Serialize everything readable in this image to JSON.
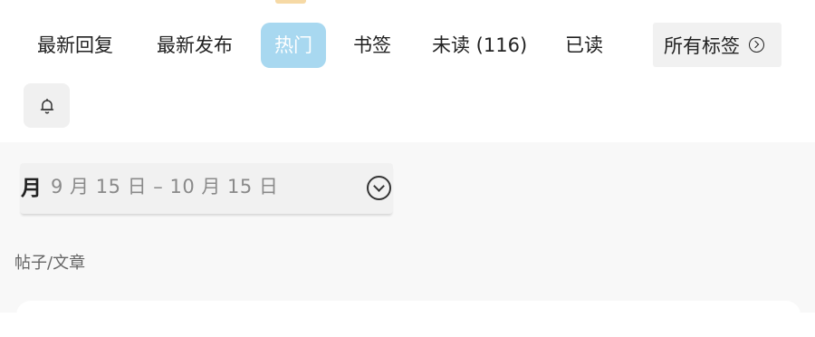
{
  "nav": {
    "tabs": [
      {
        "label": "最新回复",
        "active": false
      },
      {
        "label": "最新发布",
        "active": false
      },
      {
        "label": "热门",
        "active": true
      },
      {
        "label": "书签",
        "active": false
      },
      {
        "label": "未读 (116)",
        "active": false
      },
      {
        "label": "已读",
        "active": false
      }
    ],
    "all_tags_label": "所有标签",
    "active_color": "#a8d8f0"
  },
  "icons": {
    "all_tags": "chevron-right-circle-icon",
    "notifications": "bell-icon",
    "date_dropdown": "chevron-down-circle-icon"
  },
  "filter": {
    "period": "月",
    "range": "9 月 15 日 – 10 月 15 日"
  },
  "section": {
    "label": "帖子/文章"
  }
}
